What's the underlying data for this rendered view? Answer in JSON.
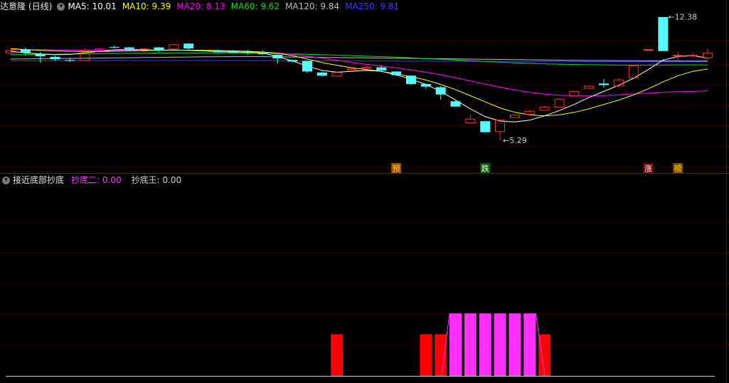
{
  "main_header": {
    "stock_name": "达意隆",
    "period": "(日线)",
    "indicators": [
      {
        "label": "MA5:",
        "value": "10.01",
        "color": "#ffffff"
      },
      {
        "label": "MA10:",
        "value": "9.39",
        "color": "#ffff00"
      },
      {
        "label": "MA20:",
        "value": "8.13",
        "color": "#ff00ff"
      },
      {
        "label": "MA60:",
        "value": "9.62",
        "color": "#00e600"
      },
      {
        "label": "MA120:",
        "value": "9.84",
        "color": "#c0c0c0"
      },
      {
        "label": "MA250:",
        "value": "9.81",
        "color": "#3c3cff"
      }
    ]
  },
  "sub_header": {
    "indicator_name": "接近底部抄底",
    "lines": [
      {
        "label": "抄底二:",
        "value": "0.00",
        "color": "#ff40ff"
      },
      {
        "label": "抄底王:",
        "value": "0.00",
        "color": "#d0d0d0"
      }
    ]
  },
  "chart_data": [
    {
      "type": "candlestick",
      "high_label": "12.38",
      "low_label": "5.29",
      "candles": [
        {
          "o": 10.31,
          "c": 10.44,
          "h": 10.5,
          "l": 10.23,
          "dir": "up"
        },
        {
          "o": 10.5,
          "c": 10.31,
          "h": 10.62,
          "l": 10.16,
          "dir": "down"
        },
        {
          "o": 10.25,
          "c": 10.11,
          "h": 10.35,
          "l": 9.75,
          "dir": "down"
        },
        {
          "o": 10.08,
          "c": 9.94,
          "h": 10.14,
          "l": 9.84,
          "dir": "down"
        },
        {
          "o": 9.9,
          "c": 9.87,
          "h": 9.97,
          "l": 9.78,
          "dir": "down"
        },
        {
          "o": 9.87,
          "c": 10.44,
          "h": 10.58,
          "l": 9.87,
          "dir": "up"
        },
        {
          "o": 10.41,
          "c": 10.53,
          "h": 10.58,
          "l": 10.41,
          "dir": "up"
        },
        {
          "o": 10.65,
          "c": 10.62,
          "h": 10.72,
          "l": 10.56,
          "dir": "down"
        },
        {
          "o": 10.62,
          "c": 10.53,
          "h": 10.65,
          "l": 10.5,
          "dir": "down"
        },
        {
          "o": 10.53,
          "c": 10.41,
          "h": 10.59,
          "l": 10.35,
          "dir": "up"
        },
        {
          "o": 10.62,
          "c": 10.44,
          "h": 10.65,
          "l": 10.38,
          "dir": "down"
        },
        {
          "o": 10.53,
          "c": 10.78,
          "h": 10.81,
          "l": 10.5,
          "dir": "up"
        },
        {
          "o": 10.84,
          "c": 10.56,
          "h": 10.87,
          "l": 10.47,
          "dir": "down"
        },
        {
          "o": 10.44,
          "c": 10.44,
          "h": 10.5,
          "l": 10.38,
          "dir": "down"
        },
        {
          "o": 10.44,
          "c": 10.35,
          "h": 10.5,
          "l": 10.29,
          "dir": "down"
        },
        {
          "o": 10.41,
          "c": 10.32,
          "h": 10.47,
          "l": 10.29,
          "dir": "down"
        },
        {
          "o": 10.38,
          "c": 10.38,
          "h": 10.47,
          "l": 10.2,
          "dir": "down"
        },
        {
          "o": 10.32,
          "c": 10.23,
          "h": 10.44,
          "l": 10.2,
          "dir": "down"
        },
        {
          "o": 10.2,
          "c": 9.99,
          "h": 10.23,
          "l": 9.69,
          "dir": "down"
        },
        {
          "o": 9.9,
          "c": 9.81,
          "h": 9.93,
          "l": 9.75,
          "dir": "down"
        },
        {
          "o": 9.84,
          "c": 9.24,
          "h": 9.87,
          "l": 9.15,
          "dir": "down"
        },
        {
          "o": 9.18,
          "c": 9.0,
          "h": 9.24,
          "l": 8.94,
          "dir": "down"
        },
        {
          "o": 8.97,
          "c": 9.18,
          "h": 9.24,
          "l": 8.94,
          "dir": "up"
        },
        {
          "o": 9.33,
          "c": 9.39,
          "h": 9.39,
          "l": 9.33,
          "dir": "up"
        },
        {
          "o": 9.42,
          "c": 9.48,
          "h": 9.57,
          "l": 9.42,
          "dir": "up"
        },
        {
          "o": 9.48,
          "c": 9.3,
          "h": 9.57,
          "l": 9.27,
          "dir": "down"
        },
        {
          "o": 9.24,
          "c": 9.03,
          "h": 9.27,
          "l": 8.97,
          "dir": "down"
        },
        {
          "o": 9.0,
          "c": 8.52,
          "h": 9.03,
          "l": 8.46,
          "dir": "down"
        },
        {
          "o": 8.52,
          "c": 8.37,
          "h": 8.55,
          "l": 8.25,
          "dir": "down"
        },
        {
          "o": 8.34,
          "c": 7.92,
          "h": 8.4,
          "l": 7.62,
          "dir": "down"
        },
        {
          "o": 7.53,
          "c": 7.23,
          "h": 7.56,
          "l": 7.2,
          "dir": "down"
        },
        {
          "o": 6.3,
          "c": 6.51,
          "h": 6.78,
          "l": 6.3,
          "dir": "up"
        },
        {
          "o": 6.39,
          "c": 5.76,
          "h": 6.42,
          "l": 5.73,
          "dir": "down"
        },
        {
          "o": 5.79,
          "c": 6.45,
          "h": 6.48,
          "l": 5.29,
          "dir": "up"
        },
        {
          "o": 6.6,
          "c": 6.75,
          "h": 6.78,
          "l": 6.6,
          "dir": "up"
        },
        {
          "o": 6.78,
          "c": 6.96,
          "h": 7.02,
          "l": 6.75,
          "dir": "up"
        },
        {
          "o": 7.02,
          "c": 7.2,
          "h": 7.26,
          "l": 6.99,
          "dir": "up"
        },
        {
          "o": 7.2,
          "c": 7.65,
          "h": 7.71,
          "l": 7.2,
          "dir": "up"
        },
        {
          "o": 7.83,
          "c": 8.1,
          "h": 8.13,
          "l": 7.83,
          "dir": "up"
        },
        {
          "o": 8.28,
          "c": 8.4,
          "h": 8.43,
          "l": 8.28,
          "dir": "up"
        },
        {
          "o": 8.55,
          "c": 8.46,
          "h": 8.82,
          "l": 8.31,
          "dir": "down"
        },
        {
          "o": 8.4,
          "c": 8.76,
          "h": 8.85,
          "l": 8.4,
          "dir": "up"
        },
        {
          "o": 8.88,
          "c": 9.57,
          "h": 9.6,
          "l": 8.88,
          "dir": "up"
        },
        {
          "o": 10.5,
          "c": 10.5,
          "h": 10.5,
          "l": 10.5,
          "dir": "up"
        },
        {
          "o": 10.41,
          "c": 12.36,
          "h": 12.38,
          "l": 10.41,
          "dir": "down"
        },
        {
          "o": 10.17,
          "c": 10.17,
          "h": 10.35,
          "l": 9.87,
          "dir": "up"
        },
        {
          "o": 10.17,
          "c": 10.17,
          "h": 10.29,
          "l": 10.05,
          "dir": "up"
        },
        {
          "o": 10.02,
          "c": 10.29,
          "h": 10.56,
          "l": 9.93,
          "dir": "up"
        }
      ],
      "ma5": [
        10.4,
        10.3,
        10.25,
        10.2,
        10.22,
        10.3,
        10.4,
        10.48,
        10.5,
        10.48,
        10.46,
        10.47,
        10.45,
        10.42,
        10.38,
        10.36,
        10.34,
        10.3,
        10.1,
        9.85,
        9.55,
        9.3,
        9.2,
        9.25,
        9.3,
        9.25,
        9.05,
        8.8,
        8.5,
        8.1,
        7.6,
        7.1,
        6.65,
        6.4,
        6.35,
        6.45,
        6.7,
        7.0,
        7.35,
        7.75,
        8.1,
        8.45,
        8.85,
        9.35,
        9.9,
        10.1,
        10.15,
        10.01
      ],
      "ma10": [
        10.55,
        10.5,
        10.45,
        10.42,
        10.4,
        10.38,
        10.38,
        10.4,
        10.42,
        10.44,
        10.45,
        10.46,
        10.46,
        10.45,
        10.44,
        10.42,
        10.4,
        10.36,
        10.28,
        10.15,
        9.95,
        9.75,
        9.6,
        9.45,
        9.35,
        9.25,
        9.1,
        8.95,
        8.75,
        8.5,
        8.2,
        7.85,
        7.5,
        7.15,
        6.9,
        6.75,
        6.7,
        6.75,
        6.9,
        7.1,
        7.35,
        7.6,
        7.9,
        8.25,
        8.65,
        9.0,
        9.25,
        9.39
      ],
      "ma20": [
        10.5,
        10.5,
        10.49,
        10.48,
        10.47,
        10.46,
        10.46,
        10.46,
        10.46,
        10.46,
        10.46,
        10.46,
        10.46,
        10.45,
        10.44,
        10.42,
        10.4,
        10.35,
        10.3,
        10.22,
        10.12,
        10.0,
        9.88,
        9.76,
        9.65,
        9.55,
        9.45,
        9.33,
        9.2,
        9.05,
        8.88,
        8.7,
        8.52,
        8.34,
        8.18,
        8.05,
        7.95,
        7.88,
        7.85,
        7.84,
        7.86,
        7.9,
        7.95,
        8.0,
        8.05,
        8.08,
        8.1,
        8.13
      ],
      "ma60": [
        10.2,
        10.21,
        10.22,
        10.23,
        10.24,
        10.25,
        10.26,
        10.27,
        10.28,
        10.29,
        10.3,
        10.31,
        10.31,
        10.31,
        10.31,
        10.31,
        10.3,
        10.29,
        10.27,
        10.25,
        10.23,
        10.2,
        10.18,
        10.15,
        10.12,
        10.09,
        10.06,
        10.02,
        9.98,
        9.94,
        9.9,
        9.86,
        9.82,
        9.78,
        9.74,
        9.71,
        9.68,
        9.66,
        9.64,
        9.63,
        9.62,
        9.61,
        9.61,
        9.61,
        9.61,
        9.62,
        9.62,
        9.62
      ],
      "ma120": [
        9.95,
        9.96,
        9.97,
        9.98,
        9.99,
        10.0,
        10.01,
        10.02,
        10.03,
        10.04,
        10.05,
        10.06,
        10.07,
        10.08,
        10.08,
        10.09,
        10.09,
        10.09,
        10.08,
        10.07,
        10.06,
        10.05,
        10.04,
        10.03,
        10.02,
        10.01,
        10.0,
        9.99,
        9.98,
        9.97,
        9.96,
        9.95,
        9.94,
        9.93,
        9.92,
        9.91,
        9.9,
        9.89,
        9.88,
        9.87,
        9.87,
        9.86,
        9.86,
        9.85,
        9.85,
        9.84,
        9.84,
        9.84
      ],
      "ma250": [
        9.85,
        9.85,
        9.85,
        9.86,
        9.86,
        9.86,
        9.86,
        9.87,
        9.87,
        9.87,
        9.87,
        9.87,
        9.87,
        9.87,
        9.87,
        9.87,
        9.87,
        9.86,
        9.86,
        9.86,
        9.85,
        9.85,
        9.85,
        9.84,
        9.84,
        9.84,
        9.84,
        9.83,
        9.83,
        9.83,
        9.83,
        9.83,
        9.82,
        9.82,
        9.82,
        9.82,
        9.82,
        9.82,
        9.81,
        9.81,
        9.81,
        9.81,
        9.81,
        9.81,
        9.81,
        9.81,
        9.81,
        9.81
      ],
      "markers": [
        {
          "index": 26,
          "text": "预",
          "bg": "#a05000",
          "fg": "#ffd700"
        },
        {
          "index": 32,
          "text": "跌",
          "bg": "#006000",
          "fg": "#ffffff"
        },
        {
          "index": 43,
          "text": "涨",
          "bg": "#7a0000",
          "fg": "#ffffff"
        },
        {
          "index": 45,
          "text": "榜",
          "bg": "#7a5000",
          "fg": "#ffd700"
        }
      ],
      "ylim": [
        4.0,
        12.8
      ]
    },
    {
      "type": "bar",
      "bars": [
        {
          "index": 22,
          "value": 1,
          "color": "#ff0000"
        },
        {
          "index": 28,
          "value": 1,
          "color": "#ff0000"
        },
        {
          "index": 29,
          "value": 1,
          "color": "#ff0000"
        },
        {
          "index": 30,
          "value": 1.5,
          "color": "#ff30ff"
        },
        {
          "index": 31,
          "value": 1.5,
          "color": "#ff30ff"
        },
        {
          "index": 32,
          "value": 1.5,
          "color": "#ff30ff"
        },
        {
          "index": 33,
          "value": 1.5,
          "color": "#ff30ff"
        },
        {
          "index": 34,
          "value": 1.5,
          "color": "#ff30ff"
        },
        {
          "index": 35,
          "value": 1.5,
          "color": "#ff30ff"
        },
        {
          "index": 36,
          "value": 1,
          "color": "#ff0000"
        }
      ],
      "ylim": [
        0,
        2.5
      ]
    }
  ]
}
